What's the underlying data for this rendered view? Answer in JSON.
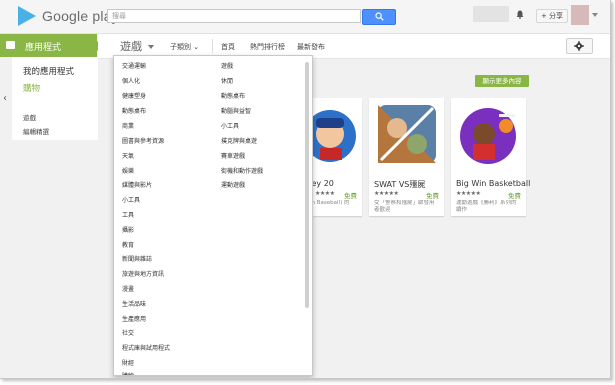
{
  "header": {
    "logo_text": "Google play",
    "search_placeholder": "搜尋",
    "share_label": "+ 分享"
  },
  "nav": {
    "apps_label": "應用程式",
    "my_apps": "我的應用程式",
    "shop": "購物",
    "games": "遊戲",
    "editors_choice": "編輯精選"
  },
  "subbar": {
    "title": "遊戲",
    "category": "子類別",
    "home": "首頁",
    "top_charts": "熱門排行榜",
    "new_releases": "最新發布"
  },
  "main": {
    "more_button": "顯示更多內容",
    "cards": [
      {
        "title": "in Hockey 20",
        "stars": "★★★★",
        "price": "免費",
        "desc": "in Baseball) 的"
      },
      {
        "title": "SWAT VS殭屍",
        "stars": "★★★★★",
        "price": "免費",
        "desc": "受「警察和殭屍」啟發用\n者歡迎"
      },
      {
        "title": "Big Win Basketball",
        "stars": "★★★★★",
        "price": "免費",
        "desc": "運動遊戲《勝利》系列的\n續作"
      }
    ]
  },
  "dropdown": {
    "col1": [
      "交通運輸",
      "個人化",
      "健康塑身",
      "動態桌布",
      "商業",
      "圖書與參考資源",
      "天氣",
      "娛樂",
      "媒體與影片",
      "小工具",
      "工具",
      "攝影",
      "教育",
      "新聞與雜誌",
      "旅遊與地方資訊",
      "漫畫",
      "生活品味",
      "生產應用",
      "社交",
      "程式庫與試用程式",
      "財經",
      "購物"
    ],
    "col2": [
      "遊戲",
      "休閒",
      "動態桌布",
      "動腦與益智",
      "小工具",
      "撲克牌與桌遊",
      "賽車遊戲",
      "街機和動作遊戲",
      "運動遊戲"
    ]
  }
}
